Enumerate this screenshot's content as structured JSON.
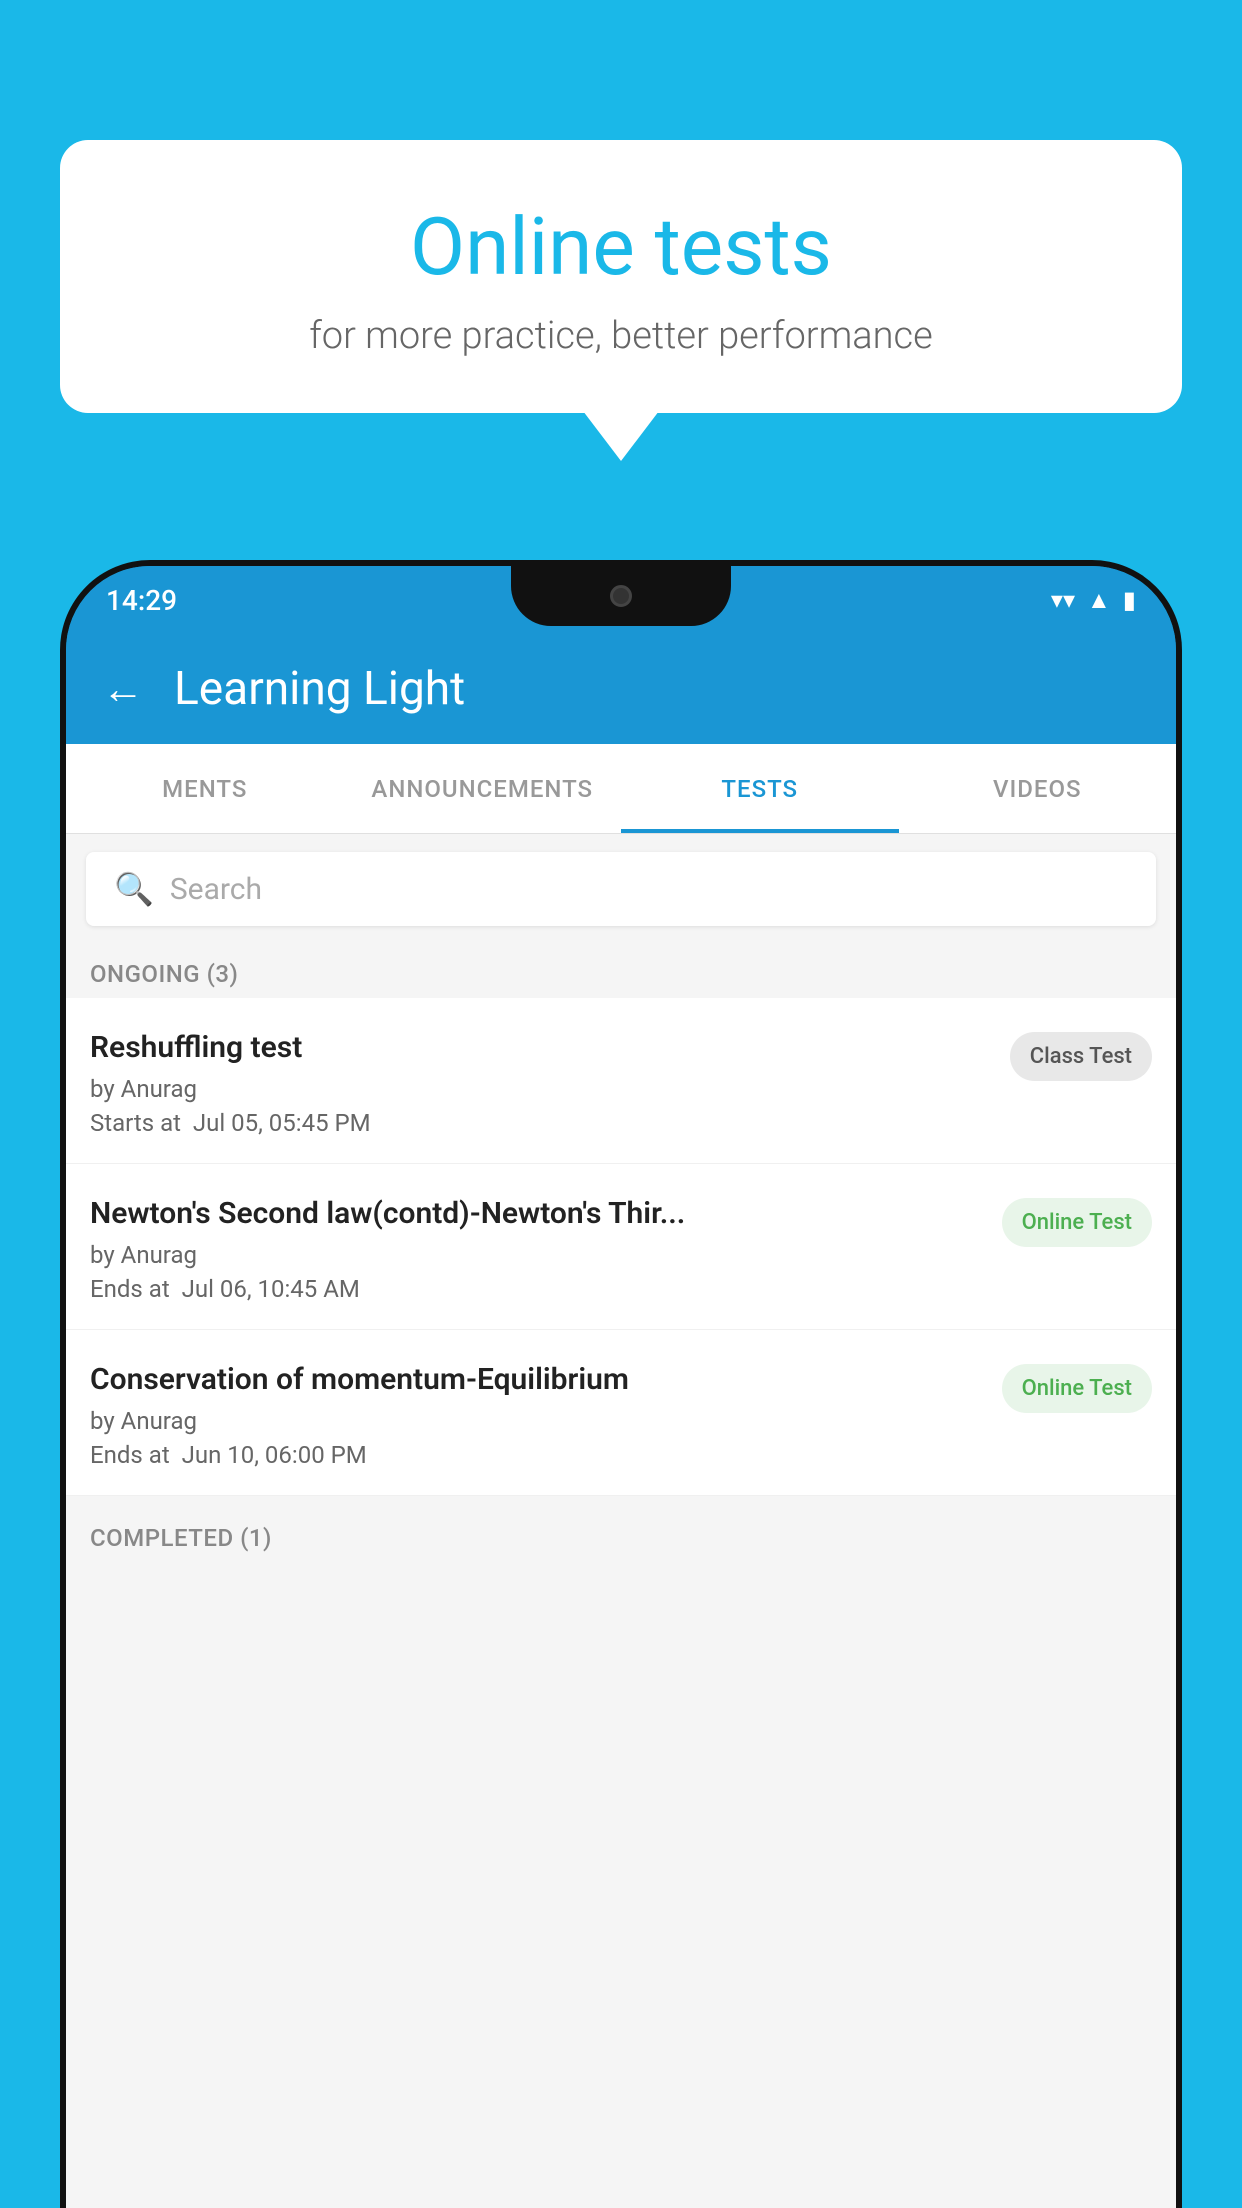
{
  "background": {
    "color": "#1ab8e8"
  },
  "bubble": {
    "title": "Online tests",
    "subtitle": "for more practice, better performance"
  },
  "status_bar": {
    "time": "14:29",
    "wifi_icon": "▼",
    "signal_icon": "◢",
    "battery_icon": "▮"
  },
  "app_bar": {
    "back_label": "←",
    "title": "Learning Light"
  },
  "tabs": [
    {
      "id": "ments",
      "label": "MENTS",
      "active": false
    },
    {
      "id": "announcements",
      "label": "ANNOUNCEMENTS",
      "active": false
    },
    {
      "id": "tests",
      "label": "TESTS",
      "active": true
    },
    {
      "id": "videos",
      "label": "VIDEOS",
      "active": false
    }
  ],
  "search": {
    "placeholder": "Search"
  },
  "sections": [
    {
      "title": "ONGOING (3)",
      "items": [
        {
          "name": "Reshuffling test",
          "author": "by Anurag",
          "date_label": "Starts at",
          "date": "Jul 05, 05:45 PM",
          "badge": "Class Test",
          "badge_type": "class"
        },
        {
          "name": "Newton's Second law(contd)-Newton's Thir...",
          "author": "by Anurag",
          "date_label": "Ends at",
          "date": "Jul 06, 10:45 AM",
          "badge": "Online Test",
          "badge_type": "online"
        },
        {
          "name": "Conservation of momentum-Equilibrium",
          "author": "by Anurag",
          "date_label": "Ends at",
          "date": "Jun 10, 06:00 PM",
          "badge": "Online Test",
          "badge_type": "online"
        }
      ]
    }
  ],
  "completed_section": {
    "title": "COMPLETED (1)"
  }
}
